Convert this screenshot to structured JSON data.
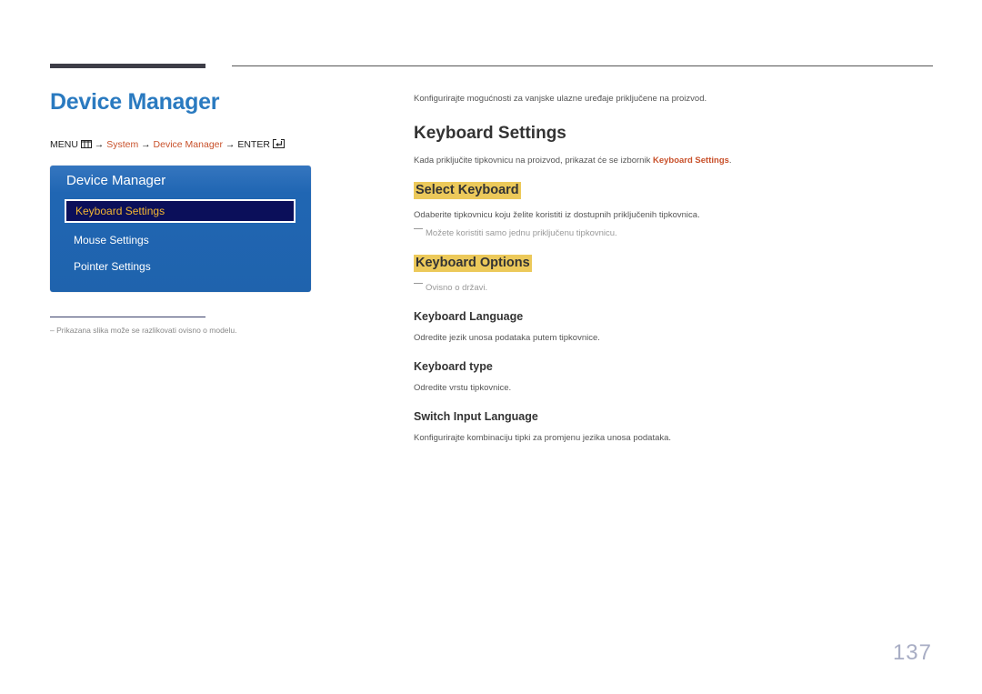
{
  "left": {
    "page_title": "Device Manager",
    "breadcrumb": {
      "menu": "MENU",
      "arrow": "→",
      "system": "System",
      "device_manager": "Device Manager",
      "enter": "ENTER"
    },
    "menu_panel": {
      "title": "Device Manager",
      "items": [
        {
          "label": "Keyboard Settings",
          "selected": true
        },
        {
          "label": "Mouse Settings",
          "selected": false
        },
        {
          "label": "Pointer Settings",
          "selected": false
        }
      ]
    },
    "footnote": "Prikazana slika može se razlikovati ovisno o modelu."
  },
  "right": {
    "intro": "Konfigurirajte mogućnosti za vanjske ulazne uređaje priključene na proizvod.",
    "section_title": "Keyboard Settings",
    "section_desc_prefix": "Kada priključite tipkovnicu na proizvod, prikazat će se izbornik ",
    "section_desc_link": "Keyboard Settings",
    "section_desc_suffix": ".",
    "select_keyboard": {
      "heading": "Select Keyboard",
      "desc": "Odaberite tipkovnicu koju želite koristiti iz dostupnih priključenih tipkovnica.",
      "note": "Možete koristiti samo jednu priključenu tipkovnicu."
    },
    "keyboard_options": {
      "heading": "Keyboard Options",
      "note": "Ovisno o državi.",
      "items": [
        {
          "title": "Keyboard Language",
          "desc": "Odredite jezik unosa podataka putem tipkovnice."
        },
        {
          "title": "Keyboard type",
          "desc": "Odredite vrstu tipkovnice."
        },
        {
          "title": "Switch Input Language",
          "desc": "Konfigurirajte kombinaciju tipki za promjenu jezika unosa podataka."
        }
      ]
    }
  },
  "page_number": "137",
  "colors": {
    "title_blue": "#2a7ac0",
    "link_orange": "#c8502a",
    "highlight_yellow": "#ecc95a",
    "panel_blue": "#1f63ad",
    "selected_bg": "#0b0f5a",
    "selected_text": "#f2b632"
  }
}
